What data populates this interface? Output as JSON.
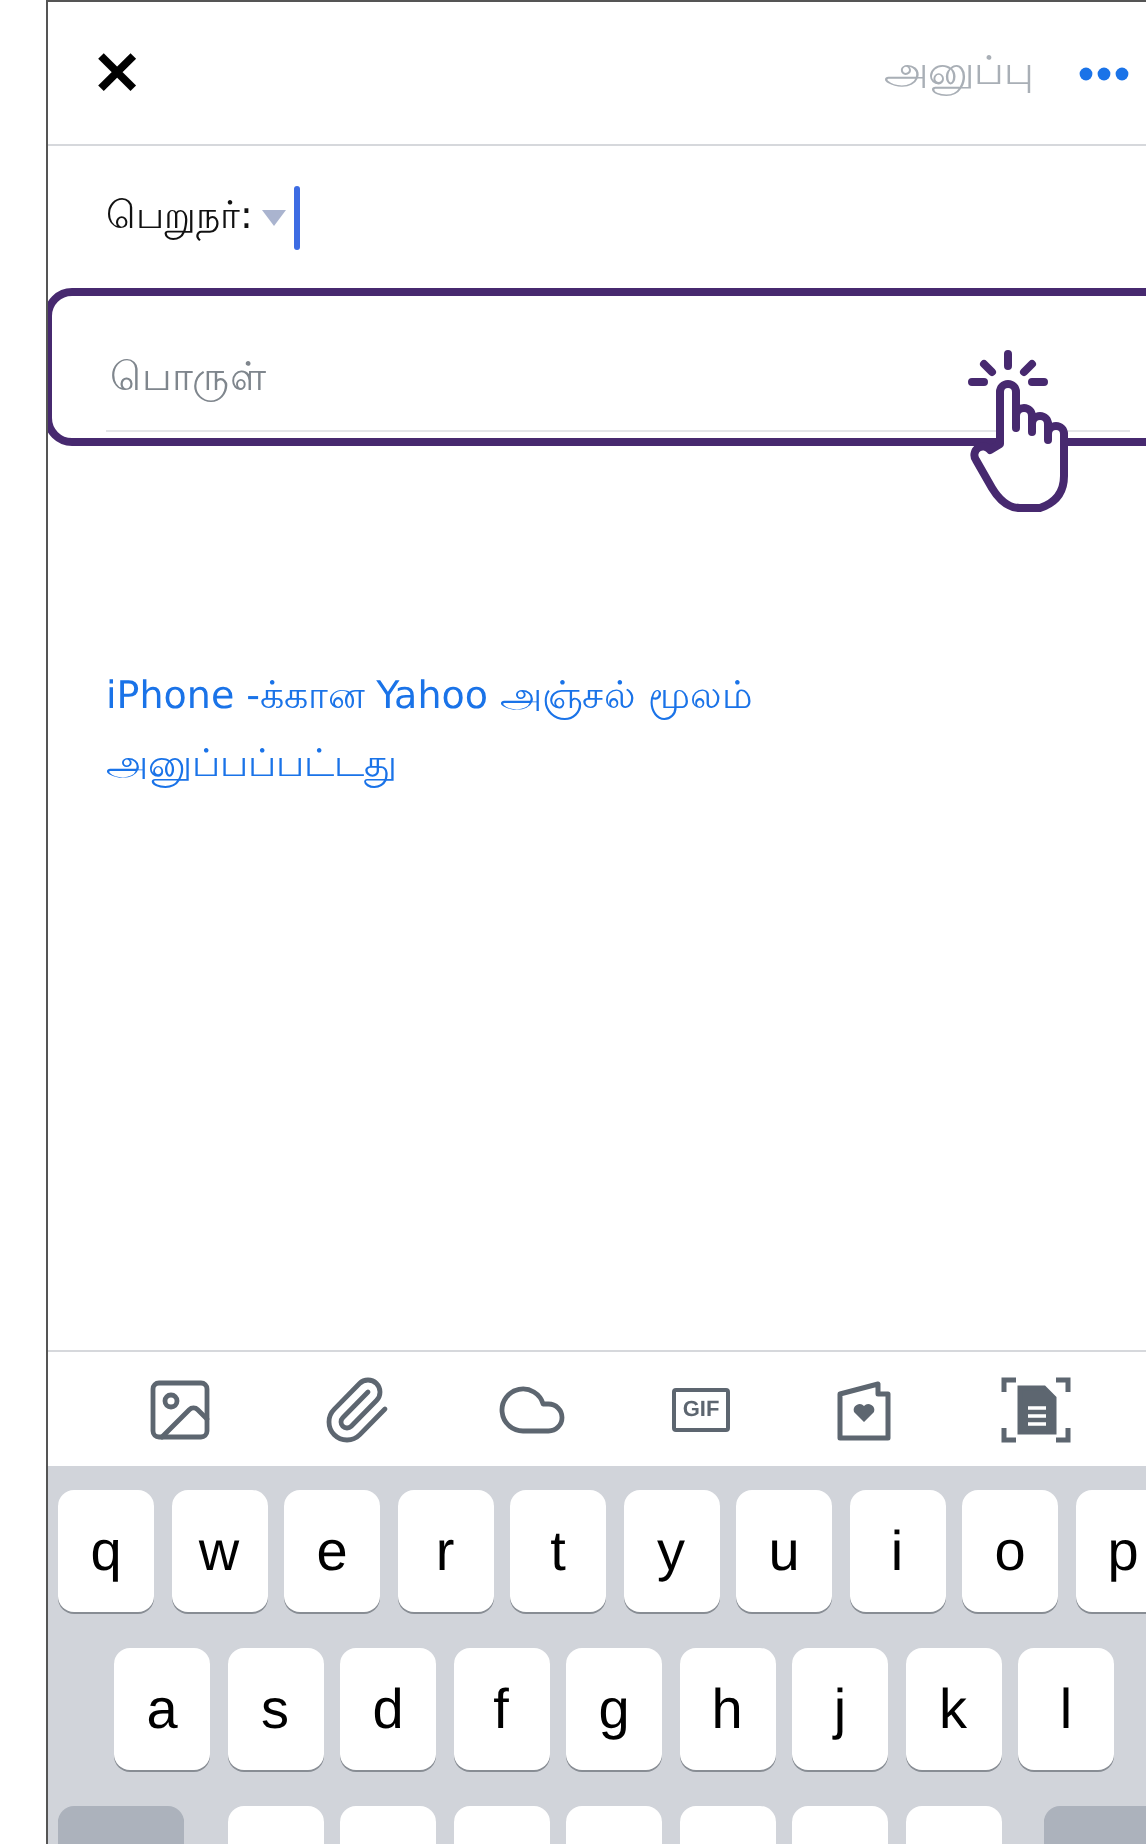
{
  "header": {
    "close_label": "✕",
    "send_label": "அனுப்பு",
    "send_disabled": true
  },
  "recipient": {
    "label": "பெறுநர்:"
  },
  "subject": {
    "placeholder": "பொருள்",
    "highlighted": true
  },
  "signature": {
    "lines": [
      "iPhone -க்கான Yahoo அஞ்சல் மூலம்",
      "அனுப்பப்பட்டது"
    ]
  },
  "toolbar": [
    {
      "kind": "photo"
    },
    {
      "kind": "attach"
    },
    {
      "kind": "cloud"
    },
    {
      "kind": "gif",
      "label": "GIF"
    },
    {
      "kind": "card"
    },
    {
      "kind": "scan"
    }
  ],
  "keyboard": {
    "rows": [
      [
        {
          "kind": "letter",
          "label": "q"
        },
        {
          "kind": "letter",
          "label": "w"
        },
        {
          "kind": "letter",
          "label": "e"
        },
        {
          "kind": "letter",
          "label": "r"
        },
        {
          "kind": "letter",
          "label": "t"
        },
        {
          "kind": "letter",
          "label": "y"
        },
        {
          "kind": "letter",
          "label": "u"
        },
        {
          "kind": "letter",
          "label": "i"
        },
        {
          "kind": "letter",
          "label": "o"
        },
        {
          "kind": "letter",
          "label": "p"
        }
      ],
      [
        {
          "kind": "letter",
          "label": "a"
        },
        {
          "kind": "letter",
          "label": "s"
        },
        {
          "kind": "letter",
          "label": "d"
        },
        {
          "kind": "letter",
          "label": "f"
        },
        {
          "kind": "letter",
          "label": "g"
        },
        {
          "kind": "letter",
          "label": "h"
        },
        {
          "kind": "letter",
          "label": "j"
        },
        {
          "kind": "letter",
          "label": "k"
        },
        {
          "kind": "letter",
          "label": "l"
        }
      ],
      [
        {
          "kind": "function"
        },
        {
          "kind": "letter"
        },
        {
          "kind": "letter"
        },
        {
          "kind": "letter"
        },
        {
          "kind": "letter"
        },
        {
          "kind": "letter"
        },
        {
          "kind": "letter"
        },
        {
          "kind": "letter"
        },
        {
          "kind": "function"
        }
      ]
    ]
  }
}
